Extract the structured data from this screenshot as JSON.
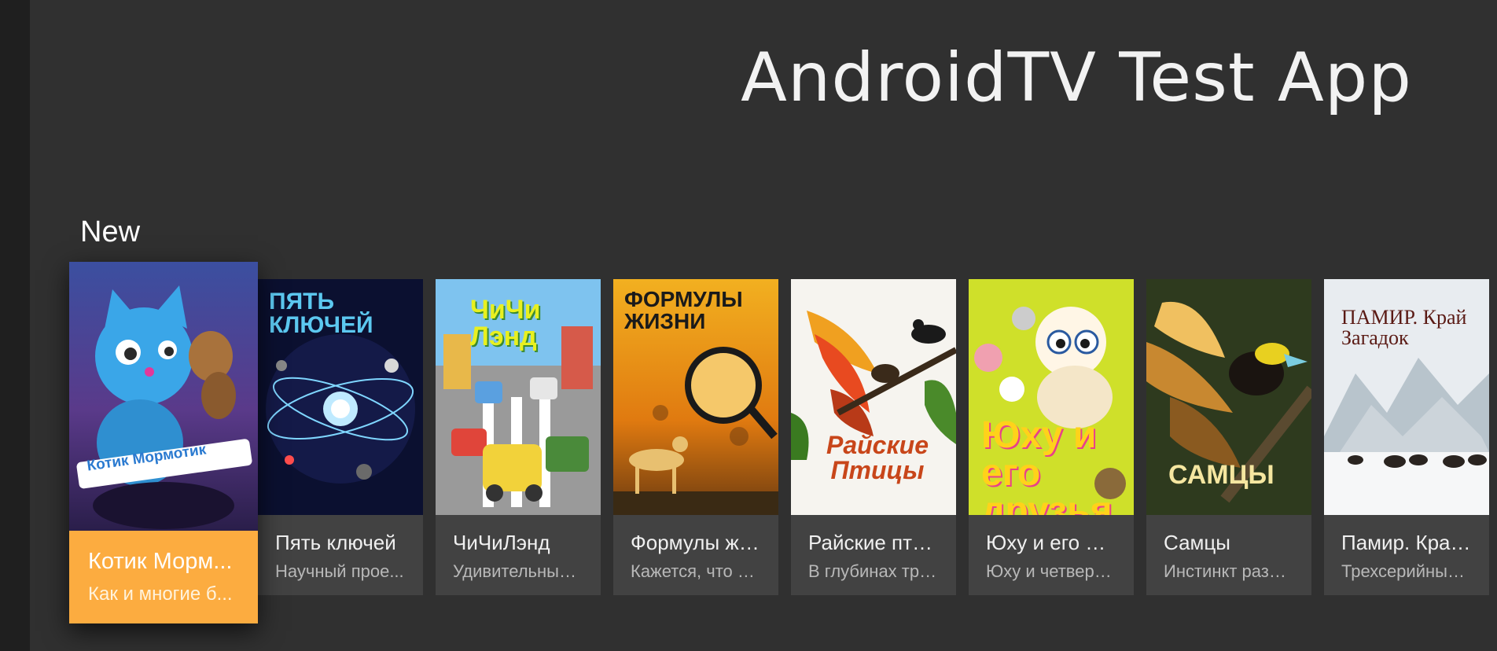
{
  "app": {
    "title": "AndroidTV Test App"
  },
  "row": {
    "header": "New",
    "focused_index": 0,
    "cards": [
      {
        "title": "Котик Морм...",
        "description": "Как и многие б...",
        "poster_text": "Котик Мормотик",
        "poster_icon": "blue-cat-cartoon-poster"
      },
      {
        "title": "Пять ключей",
        "description": "Научный прое...",
        "poster_text": "ПЯТЬ КЛЮЧЕЙ",
        "poster_icon": "space-atom-poster"
      },
      {
        "title": "ЧиЧиЛэнд",
        "description": "Удивительный ...",
        "poster_text": "ЧиЧи Лэнд",
        "poster_icon": "toy-cars-city-poster"
      },
      {
        "title": "Формулы жи...",
        "description": "Кажется, что ж...",
        "poster_text": "ФОРМУЛЫ ЖИЗНИ",
        "poster_icon": "cheetah-magnifier-poster"
      },
      {
        "title": "Райские пти...",
        "description": "В глубинах тро...",
        "poster_text": "Райские Птицы",
        "poster_icon": "bird-of-paradise-poster"
      },
      {
        "title": "Юху и его др...",
        "description": "Юху и четверо ...",
        "poster_text": "Юху и его друзья",
        "poster_icon": "cartoon-animals-poster"
      },
      {
        "title": "Самцы",
        "description": "Инстинкт разм...",
        "poster_text": "САМЦЫ",
        "poster_icon": "bird-display-poster"
      },
      {
        "title": "Памир. Край...",
        "description": "Трехсерийный ...",
        "poster_text": "ПАМИР. Край Загадок",
        "poster_icon": "mountain-yaks-poster"
      }
    ]
  },
  "colors": {
    "background": "#303030",
    "rail": "#1f1f1f",
    "card": "#424242",
    "focused_card": "#fcac40"
  }
}
